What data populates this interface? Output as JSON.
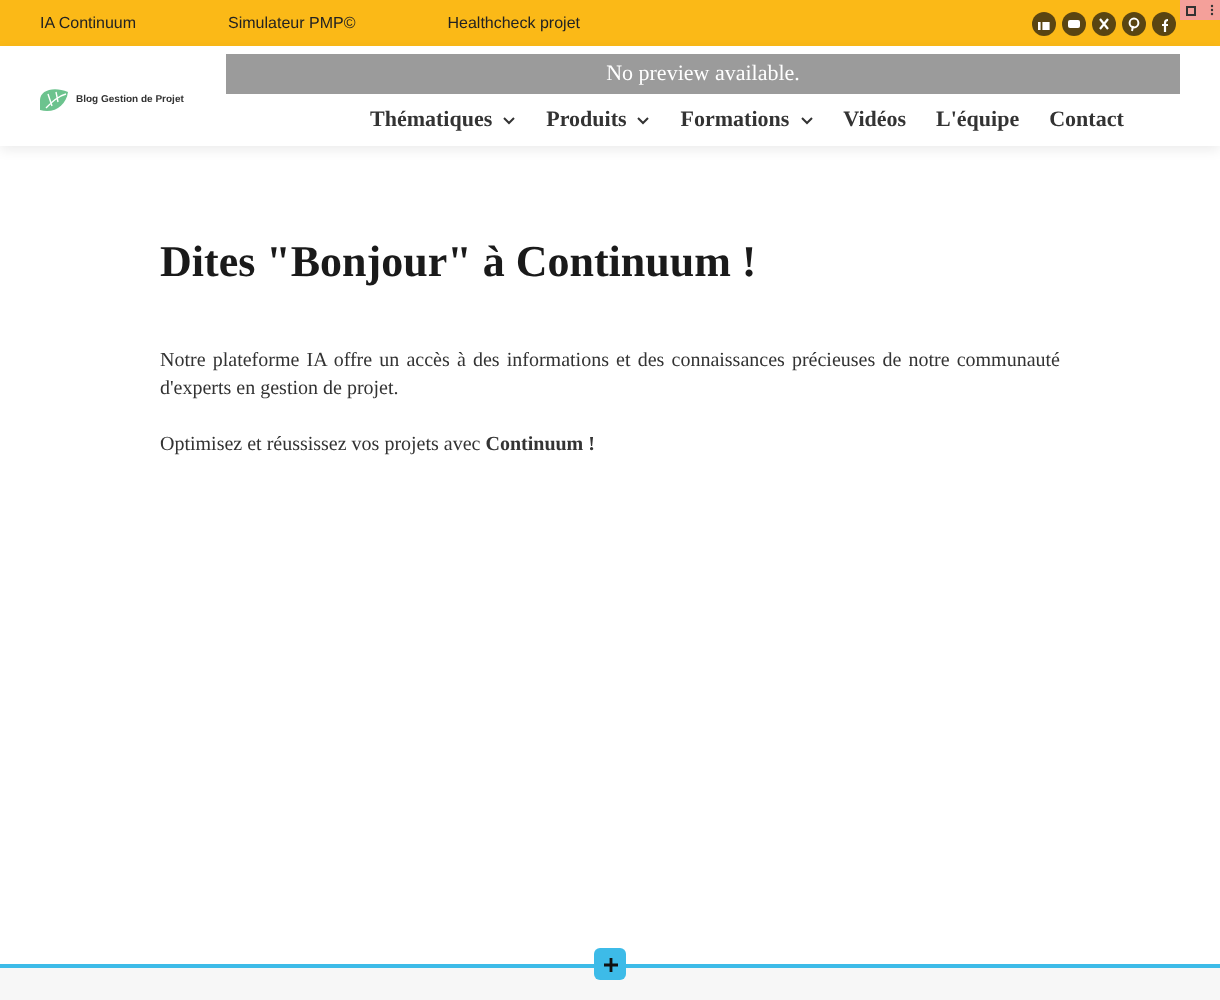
{
  "top_bar": {
    "links": [
      "IA Continuum",
      "Simulateur PMP©",
      "Healthcheck projet"
    ]
  },
  "header": {
    "logo_text": "Blog Gestion de Projet",
    "preview_notice": "No preview available.",
    "nav": [
      {
        "label": "Thématiques",
        "has_dropdown": true
      },
      {
        "label": "Produits",
        "has_dropdown": true
      },
      {
        "label": "Formations",
        "has_dropdown": true
      },
      {
        "label": "Vidéos",
        "has_dropdown": false
      },
      {
        "label": "L'équipe",
        "has_dropdown": false
      },
      {
        "label": "Contact",
        "has_dropdown": false
      }
    ]
  },
  "content": {
    "heading": "Dites \"Bonjour\" à Continuum !",
    "paragraphs": [
      "Notre plateforme IA offre un accès à des informations et des connaissances précieuses de notre communauté d'experts en gestion de projet.",
      "Optimisez et réussissez vos projets avec **Continuum !**"
    ]
  }
}
